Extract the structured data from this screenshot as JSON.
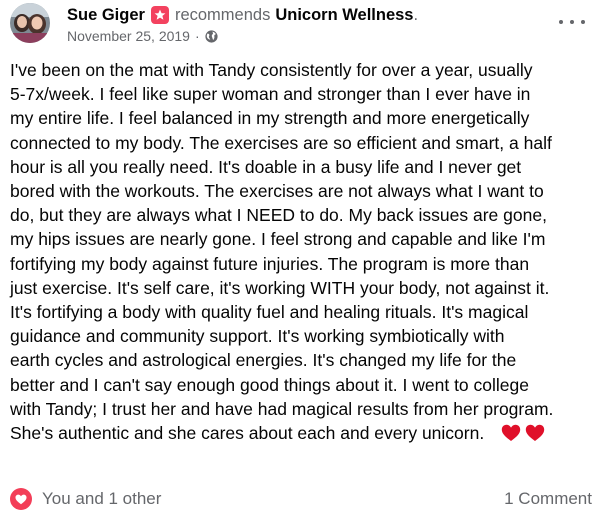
{
  "post": {
    "author": "Sue Giger",
    "action_text": "recommends",
    "page_name": "Unicorn Wellness",
    "page_name_suffix": ".",
    "date": "November 25, 2019",
    "separator": "·",
    "privacy_icon": "globe-icon",
    "badge_icon": "recommend-flag-icon",
    "badge_color": "#f3425f",
    "more_icon": "more-options-icon",
    "body_lines": [
      "I've been on the mat with Tandy consistently for over a year, usually",
      "5-7x/week.  I feel like super woman and stronger than I ever have in",
      "my entire life.  I feel balanced in my strength and more energetically",
      "connected to my body.  The exercises are so efficient and smart, a half",
      "hour is all you really need.  It's doable in a busy life and I never get",
      "bored with the workouts.  The exercises are not always what I want to",
      "do, but they are always what I NEED to do.  My back issues are gone,",
      "my hips issues are nearly gone.  I feel strong and capable and like I'm",
      "fortifying my body against future injuries.  The program is more than",
      "just exercise.  It's self care, it's working WITH your body, not against it.",
      "It's fortifying a body with quality fuel and healing rituals.  It's magical",
      "guidance and community support.  It's working symbiotically with",
      "earth cycles and astrological energies.  It's changed my life for the",
      "better and I can't say enough good things about it.  I went to college",
      "with Tandy; I trust her and have had magical results from her program.",
      "She's authentic and she cares about each and every unicorn."
    ],
    "body_emoji": [
      "red-heart-icon",
      "red-heart-icon"
    ],
    "heart_color": "#e0102a"
  },
  "footer": {
    "reaction_icon": "love-reaction-icon",
    "reaction_color": "#f33e58",
    "reactions_text": "You and 1 other",
    "comments_text": "1 Comment"
  }
}
